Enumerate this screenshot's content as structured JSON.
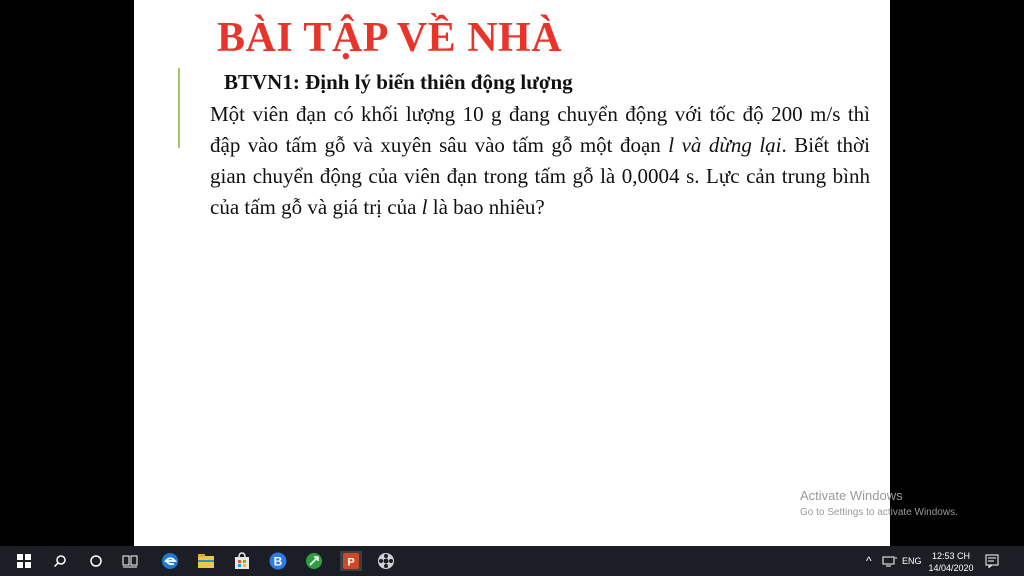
{
  "slide": {
    "title": "BÀI TẬP VỀ NHÀ",
    "subtitle": "BTVN1: Định lý biến thiên động lượng",
    "body": {
      "p1": "Một viên đạn có khối lượng 10 g đang chuyển động với tốc độ 200 m/s thì đập vào tấm gỗ và xuyên sâu vào tấm gỗ một đoạn ",
      "var_l": "l",
      "italic_phrase": " và dừng lại",
      "p2": ". Biết thời gian chuyển động của viên đạn trong tấm gỗ là 0,0004 s. Lực cản trung bình của tấm gỗ và giá trị của ",
      "var_l2": "l",
      "p3": " là bao nhiêu?"
    }
  },
  "watermark": {
    "line1": "Activate Windows",
    "line2": "Go to Settings to activate Windows."
  },
  "taskbar": {
    "tray_caret": "^",
    "language": "ENG",
    "time": "12:53 CH",
    "date": "14/04/2020"
  },
  "colors": {
    "title": "#e8342a",
    "accent_line": "#a7c46a",
    "taskbar": "#1b1f25"
  }
}
